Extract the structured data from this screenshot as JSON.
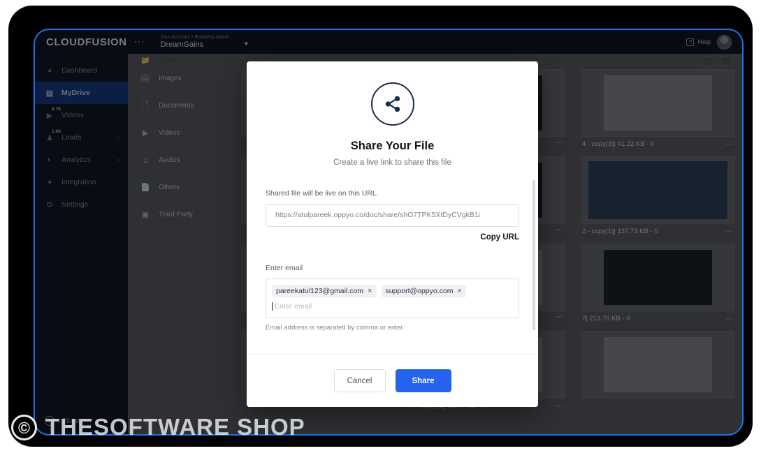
{
  "app": {
    "brand": "CLOUDFUSION",
    "kebab_icon": "kebab-vertical-icon",
    "account_breadcrumb": "Your Account > Business Name",
    "account_name": "DreamGains",
    "chevron_icon": "chevron-down-icon",
    "help_label": "Help",
    "help_icon": "question-mark-icon",
    "avatar_icon": "user-avatar"
  },
  "sidebar": {
    "items": [
      {
        "label": "Dashboard",
        "icon": "speedometer-icon",
        "badge": "",
        "arrow": false,
        "active": false
      },
      {
        "label": "MyDrive",
        "icon": "drive-icon",
        "badge": "",
        "arrow": false,
        "active": true
      },
      {
        "label": "Videos",
        "icon": "video-icon",
        "badge": "6.7K",
        "arrow": false,
        "active": false
      },
      {
        "label": "Leads",
        "icon": "people-icon",
        "badge": "1.9K",
        "arrow": true,
        "active": false
      },
      {
        "label": "Analytics",
        "icon": "pie-chart-icon",
        "badge": "",
        "arrow": true,
        "active": false
      },
      {
        "label": "Integration",
        "icon": "plug-icon",
        "badge": "",
        "arrow": false,
        "active": false
      },
      {
        "label": "Settings",
        "icon": "gear-icon",
        "badge": "",
        "arrow": false,
        "active": false
      }
    ],
    "close_label": "Close",
    "close_icon": "arrow-left-circle-icon"
  },
  "filetypes": {
    "clipped_top_label": "Folders",
    "items": [
      {
        "label": "Images",
        "icon": "image-icon"
      },
      {
        "label": "Documents",
        "icon": "document-icon"
      },
      {
        "label": "Videos",
        "icon": "video-icon"
      },
      {
        "label": "Audios",
        "icon": "music-note-icon"
      },
      {
        "label": "Others",
        "icon": "file-icon"
      },
      {
        "label": "Third Party",
        "icon": "third-party-icon"
      }
    ]
  },
  "content": {
    "view_grid_icon": "grid-view-icon",
    "view_list_icon": "list-view-icon",
    "menu_icon": "ellipsis-horizontal-icon",
    "files": [
      {
        "label": "",
        "style": "light"
      },
      {
        "label": "",
        "style": "dark"
      },
      {
        "label": "4 - copy(3)| 41.22 KB - 0",
        "style": "light"
      },
      {
        "label": "",
        "style": "light"
      },
      {
        "label": "",
        "style": "dark"
      },
      {
        "label": "2 - copy(1)| 137.73 KB - 0",
        "style": "wide"
      },
      {
        "label": "",
        "style": "light"
      },
      {
        "label": "",
        "style": "light"
      },
      {
        "label": "7| 213.70 KB - 0",
        "style": "dark"
      },
      {
        "label": "",
        "style": "light"
      },
      {
        "label": "4 - copy(2)| 35.76 KB - 0",
        "style": "light"
      },
      {
        "label": "",
        "style": "light"
      }
    ]
  },
  "modal": {
    "share_icon": "share-nodes-icon",
    "title": "Share Your File",
    "subtitle": "Create a live link to share this file",
    "url_label": "Shared file will be live on this URL.",
    "url_value": "https://atulpareek.oppyo.co/doc/share/shO7TPK5XtDyCVgkB1i",
    "copy_url_label": "Copy URL",
    "email_label": "Enter email",
    "email_chips": [
      {
        "value": "pareekatul123@gmail.com",
        "remove_icon": "close-icon"
      },
      {
        "value": "support@oppyo.com",
        "remove_icon": "close-icon"
      }
    ],
    "email_placeholder": "Enter email",
    "email_help": "Email address is separated by comma or enter.",
    "cancel_label": "Cancel",
    "share_label": "Share",
    "accent_color": "#2563eb"
  },
  "watermark": {
    "copyright_glyph": "©",
    "text": "THESOFTWARE SHOP"
  }
}
